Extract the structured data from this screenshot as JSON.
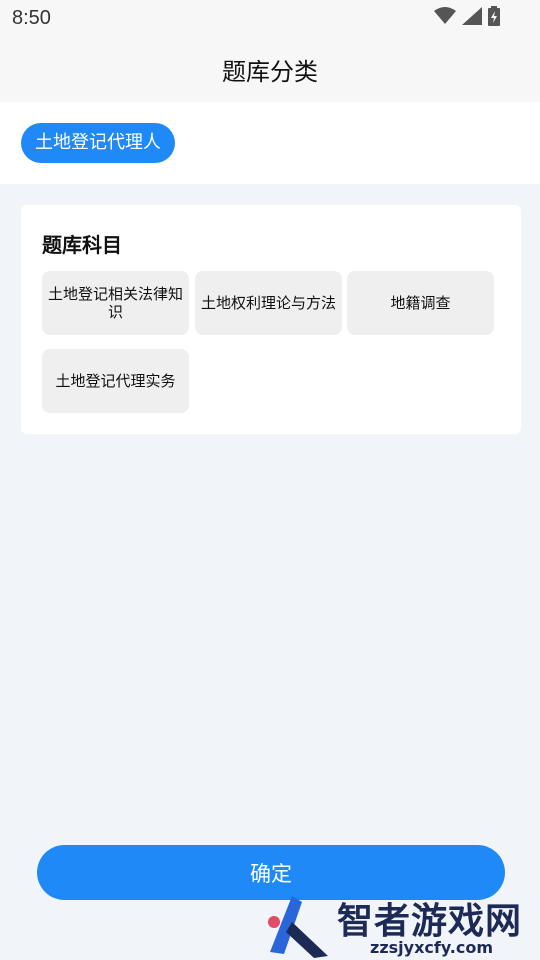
{
  "status": {
    "time": "8:50"
  },
  "header": {
    "title": "题库分类"
  },
  "category": {
    "selected": "土地登记代理人"
  },
  "subjects": {
    "title": "题库科目",
    "items": [
      {
        "label": "土地登记相关法律知识"
      },
      {
        "label": "土地权利理论与方法"
      },
      {
        "label": "地籍调查"
      },
      {
        "label": "土地登记代理实务"
      }
    ]
  },
  "actions": {
    "confirm_label": "确定"
  },
  "watermark": {
    "brand": "智者游戏网",
    "url": "zzsjyxcfy.com"
  },
  "colors": {
    "accent": "#1f8af7",
    "background": "#f1f5f9",
    "tile": "#efefef"
  }
}
